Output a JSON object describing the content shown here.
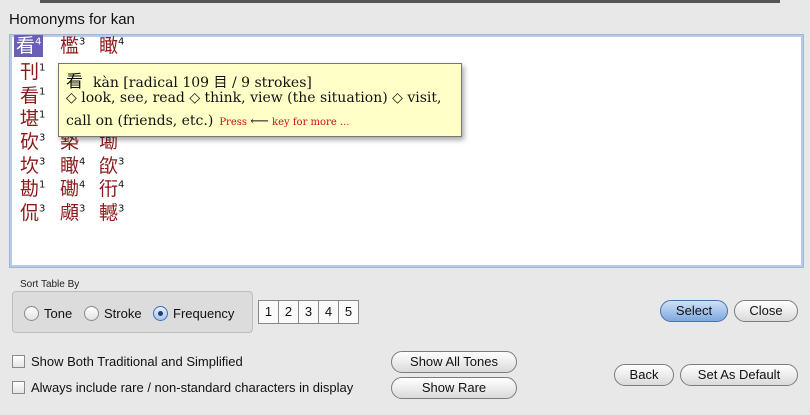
{
  "window": {
    "title": "Homonyms for kan"
  },
  "chars": [
    {
      "ch": "看",
      "tone": "4"
    },
    {
      "ch": "檻",
      "tone": "3"
    },
    {
      "ch": "瞰",
      "tone": "4"
    },
    {
      "ch": "刊",
      "tone": "1"
    },
    {
      "ch": "看",
      "tone": "1"
    },
    {
      "ch": "堪",
      "tone": "1"
    },
    {
      "ch": "砍",
      "tone": "3"
    },
    {
      "ch": "槷",
      "tone": ""
    },
    {
      "ch": "墈",
      "tone": ""
    },
    {
      "ch": "坎",
      "tone": "3"
    },
    {
      "ch": "瞰",
      "tone": "4"
    },
    {
      "ch": "欿",
      "tone": "3"
    },
    {
      "ch": "勘",
      "tone": "1"
    },
    {
      "ch": "磡",
      "tone": "4"
    },
    {
      "ch": "衎",
      "tone": "4"
    },
    {
      "ch": "侃",
      "tone": "3"
    },
    {
      "ch": "顑",
      "tone": "3"
    },
    {
      "ch": "轗",
      "tone": "3"
    }
  ],
  "tooltip": {
    "char": "看",
    "header": "kàn  [radical 109 目 / 9 strokes]",
    "line2": "◇ look, see, read ◇ think, view (the situation) ◇ visit,",
    "line3": "call on (friends, etc.)",
    "hint_pre": "Press",
    "hint_arrow": "⟵",
    "hint_post": "key for more ..."
  },
  "sort": {
    "label": "Sort Table By",
    "options": [
      {
        "label": "Tone",
        "selected": false
      },
      {
        "label": "Stroke",
        "selected": false
      },
      {
        "label": "Frequency",
        "selected": true
      }
    ],
    "pages": [
      "1",
      "2",
      "3",
      "4",
      "5"
    ]
  },
  "buttons": {
    "select": "Select",
    "close": "Close",
    "show_all_tones": "Show All Tones",
    "show_rare": "Show Rare",
    "back": "Back",
    "set_default": "Set As Default"
  },
  "checkboxes": {
    "show_both": "Show Both Traditional and Simplified",
    "include_rare": "Always include rare / non-standard characters in display"
  },
  "colors": {
    "accent": "#6b5fb3",
    "hanzi": "#8b1a1a",
    "tooltip_bg": "#ffffc8"
  }
}
